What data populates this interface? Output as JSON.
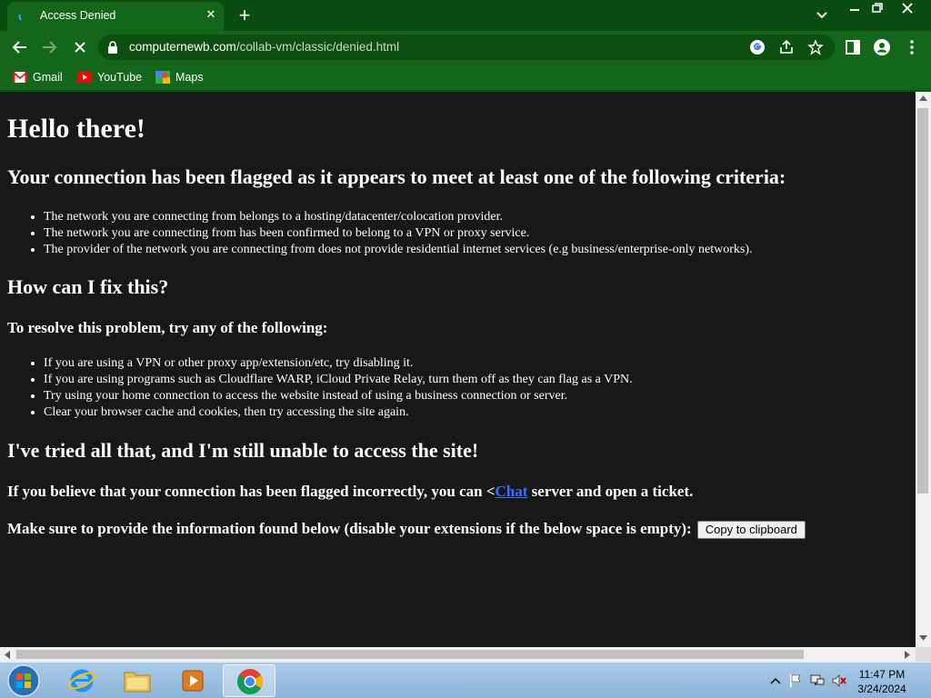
{
  "browser": {
    "tab_title": "Access Denied",
    "url_host": "computernewb.com",
    "url_path": "/collab-vm/classic/denied.html"
  },
  "bookmarks": [
    {
      "label": "Gmail",
      "icon": "gmail-icon"
    },
    {
      "label": "YouTube",
      "icon": "youtube-icon"
    },
    {
      "label": "Maps",
      "icon": "maps-icon"
    }
  ],
  "page": {
    "heading": "Hello there!",
    "flagged_heading": "Your connection has been flagged as it appears to meet at least one of the following criteria:",
    "criteria": [
      "The network you are connecting from belongs to a hosting/datacenter/colocation provider.",
      "The network you are connecting from has been confirmed to belong to a VPN or proxy service.",
      "The provider of the network you are connecting from does not provide residential internet services (e.g business/enterprise-only networks)."
    ],
    "fix_heading": "How can I fix this?",
    "resolve_subheading": "To resolve this problem, try any of the following:",
    "fixes": [
      "If you are using a VPN or other proxy app/extension/etc, try disabling it.",
      "If you are using programs such as Cloudflare WARP, iCloud Private Relay, turn them off as they can flag as a VPN.",
      "Try using your home connection to access the website instead of using a business connection or server.",
      "Clear your browser cache and cookies, then try accessing the site again."
    ],
    "tried_heading": "I've tried all that, and I'm still unable to access the site!",
    "contact_prefix": "If you believe that your connection has been flagged incorrectly, you can <",
    "contact_link": "Chat",
    "contact_suffix": " server and open a ticket.",
    "info_text": "Make sure to provide the information found below (disable your extensions if the below space is empty):",
    "copy_button": "Copy to clipboard"
  },
  "taskbar": {
    "time": "11:47 PM",
    "date": "3/24/2024"
  },
  "colors": {
    "chrome_frame": "#0b4d10",
    "chrome_toolbar": "#14661a",
    "page_background": "#181818",
    "link": "#3b6bff"
  }
}
